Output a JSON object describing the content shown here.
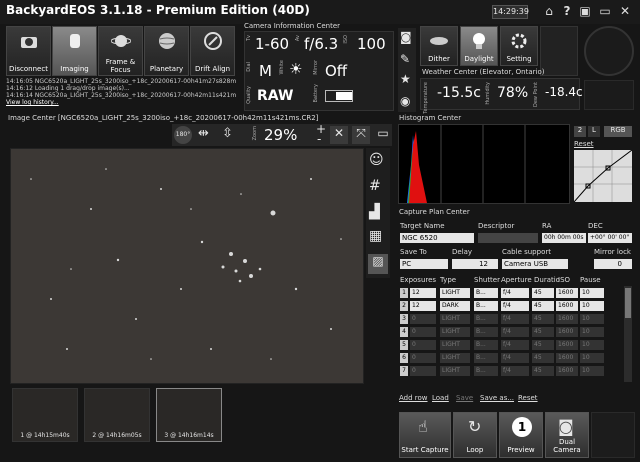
{
  "app": {
    "title": "BackyardEOS 3.1.18 - Premium Edition (40D)",
    "clock": "14:29:39"
  },
  "modes": [
    {
      "label": "Disconnect",
      "icon": "camera-icon"
    },
    {
      "label": "Imaging",
      "icon": "camera-lens-icon"
    },
    {
      "label": "Frame & Focus",
      "icon": "planet-icon"
    },
    {
      "label": "Planetary",
      "icon": "planetary-icon"
    },
    {
      "label": "Drift Align",
      "icon": "drift-align-icon"
    }
  ],
  "log": {
    "lines": [
      "14:16:05 NGC6520a_LIGHT_25s_3200iso_+18c_20200617-00h41m27s828m",
      "14:16:12 Loading 1 drag/drop image(s)...",
      "14:16:14 NGC6520a_LIGHT_25s_3200iso_+18c_20200617-00h42m11s421m"
    ],
    "view_history": "View log history..."
  },
  "camera_info": {
    "header": "Camera Information Center",
    "tv_label": "Tv",
    "tv_value": "1-60",
    "av_label": "Av",
    "av_value": "f/6.3",
    "iso_label": "ISO",
    "iso_value": "100",
    "dial_label": "Dial",
    "dial_value": "M",
    "white_label": "White",
    "mirror_label": "Mirror",
    "mirror_value": "Off",
    "quality_label": "Quality",
    "quality_value": "RAW",
    "battery_label": "Battery"
  },
  "tools": {
    "dither": "Dither",
    "daylight": "Daylight",
    "setting": "Setting"
  },
  "weather": {
    "header": "Weather Center (Elevator, Ontario)",
    "temp_label": "Temperature",
    "temp_value": "-15.5c",
    "humidity_label": "Humidity",
    "humidity_value": "78%",
    "dew_label": "Dew Point",
    "dew_value": "-18.4c"
  },
  "image_center": {
    "header": "Image Center [NGC6520a_LIGHT_25s_3200iso_+18c_20200617-00h42m11s421ms.CR2]",
    "rotate_label": "180°",
    "zoom_label": "Zoom",
    "zoom_value": "29%",
    "plus": "+",
    "minus": "-"
  },
  "thumbnails": [
    {
      "label": "1 @ 14h15m40s"
    },
    {
      "label": "2 @ 14h16m05s"
    },
    {
      "label": "3 @ 14h16m14s"
    }
  ],
  "histogram": {
    "header": "Histogram Center",
    "btn_2": "2",
    "btn_l": "L",
    "btn_rgb": "RGB",
    "reset": "Reset"
  },
  "capture_plan": {
    "header": "Capture Plan Center",
    "target_label": "Target Name",
    "target_value": "NGC 6520",
    "descriptor_label": "Descriptor",
    "ra_label": "RA",
    "ra_value": "00h 00m 00s",
    "dec_label": "DEC",
    "dec_value": "+00° 00' 00\"",
    "saveto_label": "Save To",
    "saveto_value": "PC",
    "delay_label": "Delay",
    "delay_value": "12",
    "cable_label": "Cable support",
    "cable_value": "Camera USB",
    "mirrorlock_label": "Mirror lock",
    "mirrorlock_value": "0",
    "columns": [
      "Exposures",
      "Type",
      "Shutter",
      "Aperture",
      "Duratio",
      "ISO",
      "Pause"
    ],
    "rows": [
      {
        "n": "1",
        "exp": "12",
        "type": "LIGHT",
        "shutter": "B...",
        "ap": "f/4",
        "dur": "45",
        "iso": "1600",
        "pause": "10",
        "enabled": true
      },
      {
        "n": "2",
        "exp": "12",
        "type": "DARK",
        "shutter": "B...",
        "ap": "f/4",
        "dur": "45",
        "iso": "1600",
        "pause": "10",
        "enabled": true
      },
      {
        "n": "3",
        "exp": "0",
        "type": "LIGHT",
        "shutter": "B...",
        "ap": "f/4",
        "dur": "45",
        "iso": "1600",
        "pause": "10",
        "enabled": false
      },
      {
        "n": "4",
        "exp": "0",
        "type": "LIGHT",
        "shutter": "B...",
        "ap": "f/4",
        "dur": "45",
        "iso": "1600",
        "pause": "10",
        "enabled": false
      },
      {
        "n": "5",
        "exp": "0",
        "type": "LIGHT",
        "shutter": "B...",
        "ap": "f/4",
        "dur": "45",
        "iso": "1600",
        "pause": "10",
        "enabled": false
      },
      {
        "n": "6",
        "exp": "0",
        "type": "LIGHT",
        "shutter": "B...",
        "ap": "f/4",
        "dur": "45",
        "iso": "1600",
        "pause": "10",
        "enabled": false
      },
      {
        "n": "7",
        "exp": "0",
        "type": "LIGHT",
        "shutter": "B...",
        "ap": "f/4",
        "dur": "45",
        "iso": "1600",
        "pause": "10",
        "enabled": false
      }
    ],
    "add_row": "Add row",
    "load": "Load",
    "save": "Save",
    "save_as": "Save as...",
    "reset": "Reset"
  },
  "actions": {
    "start_capture": "Start Capture",
    "loop": "Loop",
    "preview": "Preview",
    "dual_camera": "Dual Camera"
  }
}
